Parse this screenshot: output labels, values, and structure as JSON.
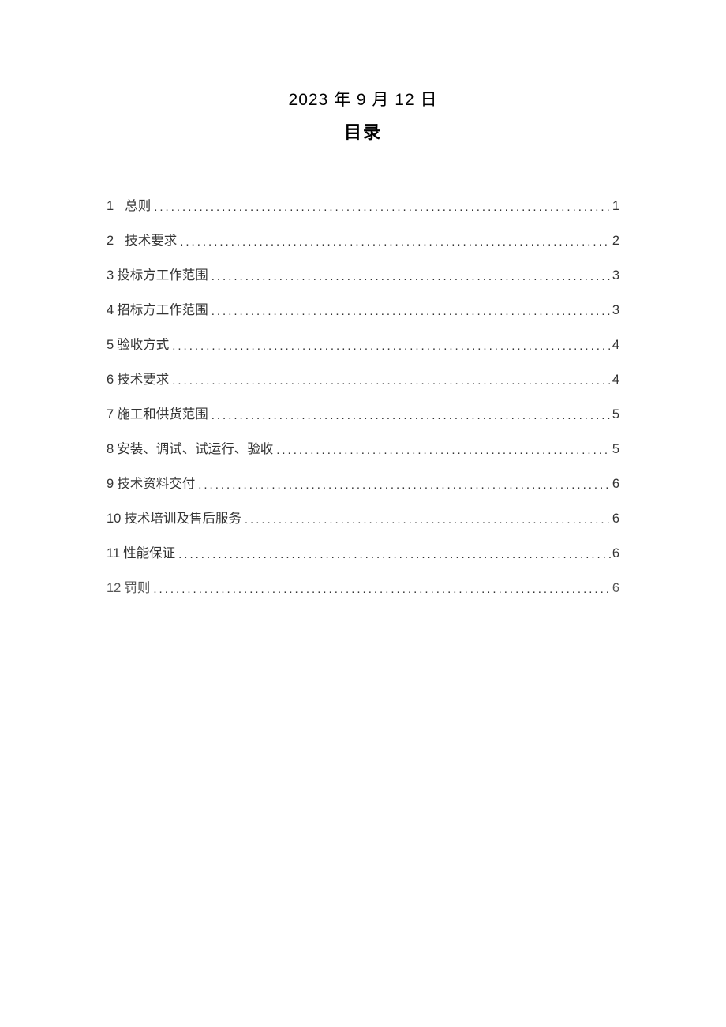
{
  "header": {
    "date": "2023 年 9 月 12 日",
    "title": "目录"
  },
  "toc": {
    "items": [
      {
        "number": "1",
        "label": "总则",
        "page": "1",
        "spaced": true
      },
      {
        "number": "2",
        "label": "技术要求",
        "page": "2",
        "spaced": true
      },
      {
        "number": "3",
        "label": "投标方工作范围",
        "page": "3",
        "spaced": false
      },
      {
        "number": "4",
        "label": "招标方工作范围",
        "page": "3",
        "spaced": false
      },
      {
        "number": "5",
        "label": "验收方式",
        "page": "4",
        "spaced": false
      },
      {
        "number": "6",
        "label": "技术要求",
        "page": "4",
        "spaced": false
      },
      {
        "number": "7",
        "label": "施工和供货范围",
        "page": "5",
        "spaced": false
      },
      {
        "number": "8",
        "label": "安装、调试、试运行、验收",
        "page": "5",
        "spaced": false
      },
      {
        "number": "9",
        "label": "技术资料交付",
        "page": "6",
        "spaced": false
      },
      {
        "number": "10",
        "label": "技术培训及售后服务",
        "page": "6",
        "spaced": false
      },
      {
        "number": "11",
        "label": "性能保证",
        "page": "6",
        "spaced": false
      },
      {
        "number": "12",
        "label": "罚则",
        "page": "6",
        "spaced": false
      }
    ]
  }
}
